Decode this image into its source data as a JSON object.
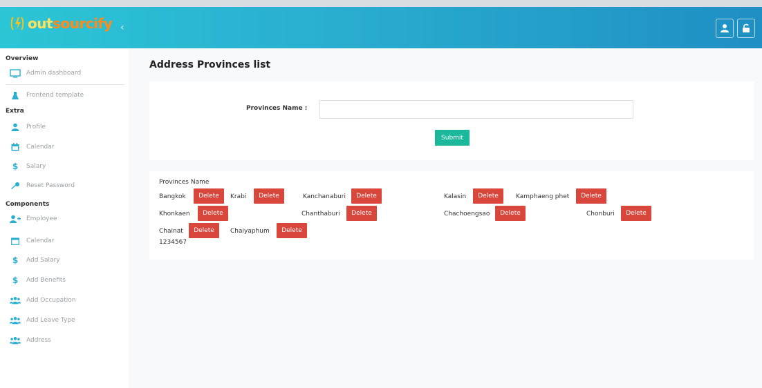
{
  "app": {
    "logo_part1": "out",
    "logo_part2": "sourcify",
    "collapse": "‹"
  },
  "sidebar": {
    "sections": [
      {
        "heading": "Overview",
        "items": [
          "Admin dashboard",
          "Frontend template"
        ]
      },
      {
        "heading": "Extra",
        "items": [
          "Profile",
          "Calendar",
          "Salary",
          "Reset Password"
        ]
      },
      {
        "heading": "Components",
        "items": [
          "Employee",
          "Calendar",
          "Add Salary",
          "Add Benefits",
          "Add Occupation",
          "Add Leave Type",
          "Address"
        ]
      }
    ]
  },
  "page": {
    "title": "Address Provinces list"
  },
  "form": {
    "label": "Provinces Name :",
    "input_value": "",
    "submit_label": "Submit"
  },
  "list": {
    "header": "Provinces Name",
    "delete_label": "Delete",
    "rows": [
      [
        "Bangkok",
        "Krabi",
        "Kanchanaburi",
        "Kalasin",
        "Kamphaeng phet"
      ],
      [
        "Khonkaen",
        "Chanthaburi",
        "Chachoengsao",
        "Chonburi"
      ],
      [
        "Chainat",
        "Chaiyaphum"
      ]
    ],
    "extra_text": "1234567"
  },
  "colors": {
    "header_gradient_start": "#2bc6d6",
    "header_gradient_end": "#1f8fc4",
    "submit": "#1bb89b",
    "delete": "#d9463b"
  }
}
